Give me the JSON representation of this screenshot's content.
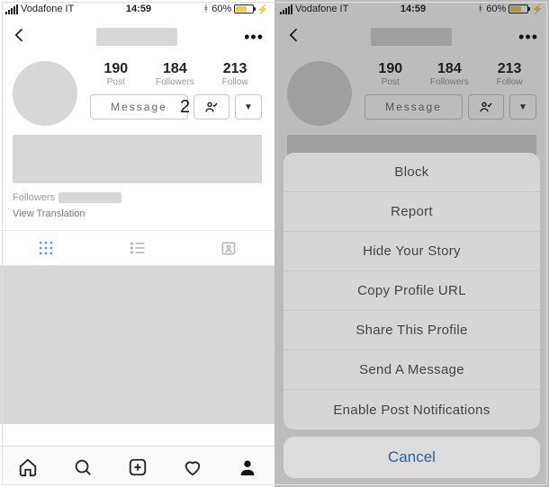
{
  "status": {
    "carrier": "Vodafone IT",
    "time": "14:59",
    "battery_pct": "60%"
  },
  "profile": {
    "stats": {
      "posts": {
        "value": "190",
        "label": "Post"
      },
      "followers": {
        "value": "184",
        "label": "Followers"
      },
      "following": {
        "value": "213",
        "label": "Follow"
      }
    },
    "message_btn": "Message",
    "followers_label": "Followers",
    "view_translation": "View Translation"
  },
  "step_marker": "2",
  "sheet": {
    "options": [
      "Block",
      "Report",
      "Hide Your Story",
      "Copy Profile URL",
      "Share This Profile",
      "Send A Message",
      "Enable Post Notifications"
    ],
    "cancel": "Cancel"
  }
}
